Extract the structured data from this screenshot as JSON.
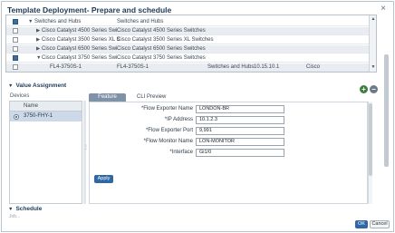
{
  "dialog": {
    "title": "Template Deployment- Prepare and schedule",
    "close_icon": "close-icon"
  },
  "devices_table": {
    "rows": [
      {
        "checked": true,
        "expanded": true,
        "indent": 1,
        "name": "Switches and Hubs",
        "family": "Switches and Hubs",
        "category": "",
        "ip": "",
        "vendor": ""
      },
      {
        "checked": false,
        "expanded": false,
        "indent": 2,
        "name": "Cisco Catalyst 4500 Series Swi",
        "family": "Cisco Catalyst 4500 Series Switches",
        "category": "",
        "ip": "",
        "vendor": ""
      },
      {
        "checked": false,
        "expanded": false,
        "indent": 2,
        "name": "Cisco Catalyst 3500 Series XL S",
        "family": "Cisco Catalyst 3500 Series XL Switches",
        "category": "",
        "ip": "",
        "vendor": ""
      },
      {
        "checked": false,
        "expanded": false,
        "indent": 2,
        "name": "Cisco Catalyst 6500 Series Swi",
        "family": "Cisco Catalyst 6500 Series Switches",
        "category": "",
        "ip": "",
        "vendor": ""
      },
      {
        "checked": true,
        "expanded": true,
        "indent": 2,
        "name": "Cisco Catalyst 3750 Series Swi",
        "family": "Cisco Catalyst 3750 Series Switches",
        "category": "",
        "ip": "",
        "vendor": ""
      },
      {
        "checked": false,
        "expanded": null,
        "indent": 3,
        "name": "FL4-3750S-1",
        "family": "FL4-3750S-1",
        "category": "Switches and Hubs",
        "ip": "10.15.10.1",
        "vendor": "Cisco"
      }
    ]
  },
  "value_assignment": {
    "heading": "Value Assignment",
    "add_icon": "add-icon",
    "remove_icon": "remove-icon",
    "devices_label": "Devices",
    "devices_column": "Name",
    "selected_device": "3750-FHY-1",
    "tabs": [
      "Feature",
      "CLI Preview"
    ],
    "active_tab": "Feature",
    "fields": [
      {
        "label": "*Flow Exporter Name",
        "value": "LONDON-BR"
      },
      {
        "label": "*IP Address",
        "value": "10.1.2.3"
      },
      {
        "label": "*Flow Exporter Port",
        "value": "9,991"
      },
      {
        "label": "*Flow Monitor Name",
        "value": "LON-MONITOR"
      },
      {
        "label": "*Interface",
        "value": "Gi1/0"
      }
    ],
    "apply_label": "Apply"
  },
  "schedule": {
    "heading": "Schedule",
    "hint": "Job..."
  },
  "footer": {
    "ok_label": "OK",
    "cancel_label": "Cancel"
  }
}
